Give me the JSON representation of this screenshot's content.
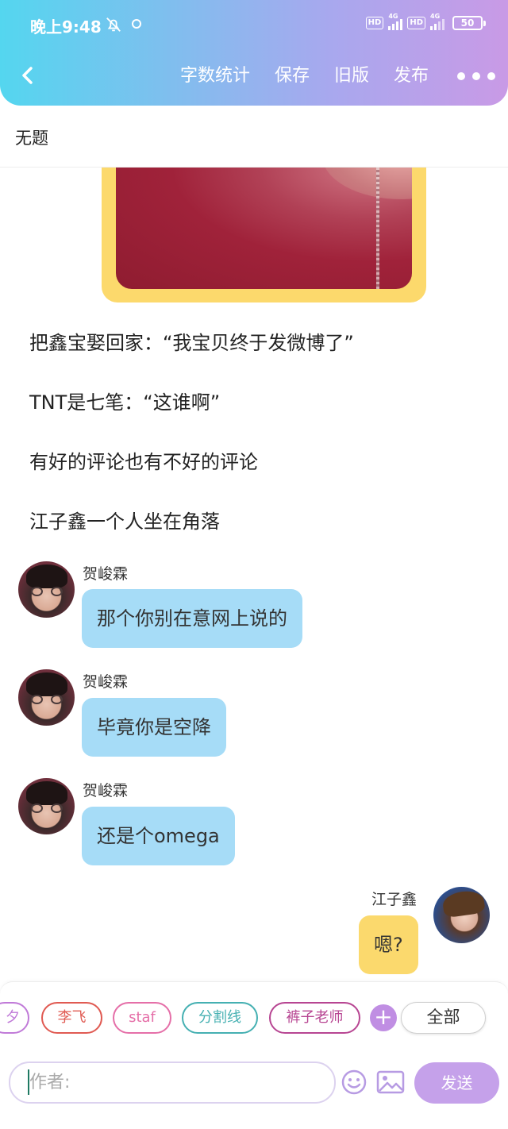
{
  "status_bar": {
    "time": "晚上9:48",
    "hd1": "HD",
    "net1": "4G",
    "hd2": "HD",
    "net2": "4G",
    "battery": "50"
  },
  "header": {
    "word_count": "字数统计",
    "save": "保存",
    "old_version": "旧版",
    "publish": "发布"
  },
  "doc": {
    "title": "无题"
  },
  "narration": [
    "把鑫宝娶回家：“我宝贝终于发微博了”",
    "TNT是七笔：“这谁啊”",
    "有好的评论也有不好的评论",
    "江子鑫一个人坐在角落"
  ],
  "messages": [
    {
      "speaker": "贺峻霖",
      "text": "那个你别在意网上说的",
      "side": "left"
    },
    {
      "speaker": "贺峻霖",
      "text": "毕竟你是空降",
      "side": "left"
    },
    {
      "speaker": "贺峻霖",
      "text": "还是个omega",
      "side": "left"
    },
    {
      "speaker": "江子鑫",
      "text": "嗯?",
      "side": "right"
    }
  ],
  "chips": [
    {
      "label": "夕",
      "color": "#c07ad8"
    },
    {
      "label": "李飞",
      "color": "#e05a52"
    },
    {
      "label": "staf",
      "color": "#e56fa8"
    },
    {
      "label": "分割线",
      "color": "#45b0b2"
    },
    {
      "label": "裤子老师",
      "color": "#b74592"
    }
  ],
  "chip_all_label": "全部",
  "input": {
    "author_placeholder": "作者:"
  },
  "send_label": "发送",
  "colors": {
    "header_gradient": [
      "#54d6ef",
      "#a8a8ee",
      "#c99ae6"
    ],
    "left_bubble": "#a6dcf7",
    "right_bubble": "#fbd96d",
    "send_button": "#c5a1ea"
  }
}
